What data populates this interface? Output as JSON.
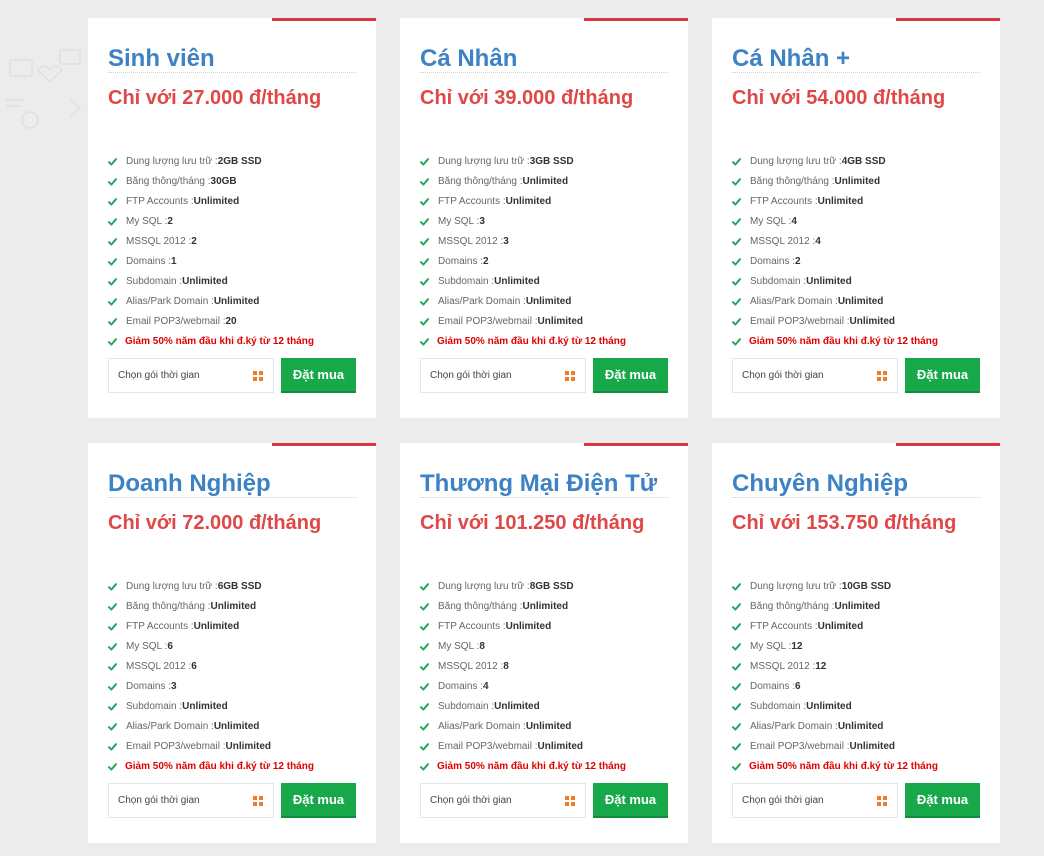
{
  "colors": {
    "background": "#ececec",
    "card": "#ffffff",
    "plan_name": "#3d82c4",
    "price": "#e04747",
    "check": "#26a65b",
    "promo": "#e00000",
    "buy_button": "#17a84a",
    "select_icon": "#f07d2a",
    "card_corner": "#d33a3a"
  },
  "icons": {
    "check": "check-icon",
    "select": "grid-icon"
  },
  "plans": [
    {
      "name": "Sinh viên",
      "price": "Chỉ với 27.000 đ/tháng",
      "features": [
        {
          "label": "Dung lượng lưu trữ : ",
          "value": "2GB SSD"
        },
        {
          "label": "Băng thông/tháng : ",
          "value": "30GB"
        },
        {
          "label": "FTP Accounts : ",
          "value": "Unlimited"
        },
        {
          "label": "My SQL : ",
          "value": "2"
        },
        {
          "label": "MSSQL 2012 : ",
          "value": "2"
        },
        {
          "label": "Domains : ",
          "value": "1"
        },
        {
          "label": "Subdomain : ",
          "value": "Unlimited"
        },
        {
          "label": "Alias/Park Domain : ",
          "value": "Unlimited"
        },
        {
          "label": "Email POP3/webmail : ",
          "value": "20"
        }
      ],
      "promo": "Giảm 50% năm đầu khi đ.ký từ 12 tháng",
      "select_placeholder": "Chọn gói thời gian",
      "buy_label": "Đặt mua"
    },
    {
      "name": "Cá Nhân",
      "price": "Chỉ với 39.000 đ/tháng",
      "features": [
        {
          "label": "Dung lượng lưu trữ : ",
          "value": "3GB SSD"
        },
        {
          "label": "Băng thông/tháng : ",
          "value": "Unlimited"
        },
        {
          "label": "FTP Accounts : ",
          "value": "Unlimited"
        },
        {
          "label": "My SQL : ",
          "value": "3"
        },
        {
          "label": "MSSQL 2012 : ",
          "value": "3"
        },
        {
          "label": "Domains : ",
          "value": "2"
        },
        {
          "label": "Subdomain : ",
          "value": "Unlimited"
        },
        {
          "label": "Alias/Park Domain : ",
          "value": "Unlimited"
        },
        {
          "label": "Email POP3/webmail : ",
          "value": "Unlimited"
        }
      ],
      "promo": "Giảm 50% năm đầu khi đ.ký từ 12 tháng",
      "select_placeholder": "Chọn gói thời gian",
      "buy_label": "Đặt mua"
    },
    {
      "name": "Cá Nhân +",
      "price": "Chỉ với 54.000 đ/tháng",
      "features": [
        {
          "label": "Dung lượng lưu trữ : ",
          "value": "4GB SSD"
        },
        {
          "label": "Băng thông/tháng : ",
          "value": "Unlimited"
        },
        {
          "label": "FTP Accounts : ",
          "value": "Unlimited"
        },
        {
          "label": "My SQL : ",
          "value": "4"
        },
        {
          "label": "MSSQL 2012 : ",
          "value": "4"
        },
        {
          "label": "Domains : ",
          "value": "2"
        },
        {
          "label": "Subdomain : ",
          "value": "Unlimited"
        },
        {
          "label": "Alias/Park Domain : ",
          "value": "Unlimited"
        },
        {
          "label": "Email POP3/webmail : ",
          "value": "Unlimited"
        }
      ],
      "promo": "Giảm 50% năm đầu khi đ.ký từ 12 tháng",
      "select_placeholder": "Chọn gói thời gian",
      "buy_label": "Đặt mua"
    },
    {
      "name": "Doanh Nghiệp",
      "price": "Chỉ với 72.000 đ/tháng",
      "features": [
        {
          "label": "Dung lượng lưu trữ : ",
          "value": "6GB SSD"
        },
        {
          "label": "Băng thông/tháng : ",
          "value": "Unlimited"
        },
        {
          "label": "FTP Accounts : ",
          "value": "Unlimited"
        },
        {
          "label": "My SQL : ",
          "value": "6"
        },
        {
          "label": "MSSQL 2012 : ",
          "value": "6"
        },
        {
          "label": "Domains : ",
          "value": "3"
        },
        {
          "label": "Subdomain : ",
          "value": "Unlimited"
        },
        {
          "label": "Alias/Park Domain : ",
          "value": "Unlimited"
        },
        {
          "label": "Email POP3/webmail : ",
          "value": "Unlimited"
        }
      ],
      "promo": "Giảm 50% năm đầu khi đ.ký từ 12 tháng",
      "select_placeholder": "Chọn gói thời gian",
      "buy_label": "Đặt mua"
    },
    {
      "name": "Thương Mại Điện Tử",
      "price": "Chỉ với 101.250 đ/tháng",
      "features": [
        {
          "label": "Dung lượng lưu trữ : ",
          "value": "8GB SSD"
        },
        {
          "label": "Băng thông/tháng : ",
          "value": "Unlimited"
        },
        {
          "label": "FTP Accounts : ",
          "value": "Unlimited"
        },
        {
          "label": "My SQL : ",
          "value": "8"
        },
        {
          "label": "MSSQL 2012 : ",
          "value": "8"
        },
        {
          "label": "Domains : ",
          "value": "4"
        },
        {
          "label": "Subdomain : ",
          "value": "Unlimited"
        },
        {
          "label": "Alias/Park Domain : ",
          "value": "Unlimited"
        },
        {
          "label": "Email POP3/webmail : ",
          "value": "Unlimited"
        }
      ],
      "promo": "Giảm 50% năm đầu khi đ.ký từ 12 tháng",
      "select_placeholder": "Chọn gói thời gian",
      "buy_label": "Đặt mua"
    },
    {
      "name": "Chuyên Nghiệp",
      "price": "Chỉ với 153.750 đ/tháng",
      "features": [
        {
          "label": "Dung lượng lưu trữ : ",
          "value": "10GB SSD"
        },
        {
          "label": "Băng thông/tháng : ",
          "value": "Unlimited"
        },
        {
          "label": "FTP Accounts : ",
          "value": "Unlimited"
        },
        {
          "label": "My SQL : ",
          "value": "12"
        },
        {
          "label": "MSSQL 2012 : ",
          "value": "12"
        },
        {
          "label": "Domains : ",
          "value": "6"
        },
        {
          "label": "Subdomain : ",
          "value": "Unlimited"
        },
        {
          "label": "Alias/Park Domain : ",
          "value": "Unlimited"
        },
        {
          "label": "Email POP3/webmail : ",
          "value": "Unlimited"
        }
      ],
      "promo": "Giảm 50% năm đầu khi đ.ký từ 12 tháng",
      "select_placeholder": "Chọn gói thời gian",
      "buy_label": "Đặt mua"
    }
  ]
}
